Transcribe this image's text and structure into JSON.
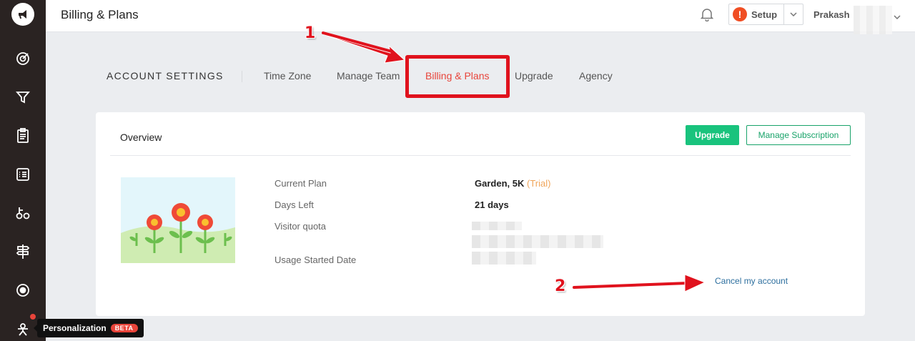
{
  "header": {
    "title": "Billing & Plans",
    "setup_label": "Setup",
    "setup_alert": "!",
    "user_name": "Prakash"
  },
  "sidebar": {
    "items": [
      {
        "icon": "target-icon"
      },
      {
        "icon": "funnel-icon"
      },
      {
        "icon": "clipboard-icon"
      },
      {
        "icon": "form-list-icon"
      },
      {
        "icon": "cycle-icon"
      },
      {
        "icon": "signpost-icon"
      },
      {
        "icon": "record-icon"
      },
      {
        "icon": "personalization-icon"
      }
    ],
    "tooltip": {
      "label": "Personalization",
      "badge": "BETA"
    }
  },
  "subnav": {
    "title": "ACCOUNT SETTINGS",
    "tabs": [
      {
        "label": "Time Zone"
      },
      {
        "label": "Manage Team"
      },
      {
        "label": "Billing & Plans",
        "active": true
      },
      {
        "label": "Upgrade"
      },
      {
        "label": "Agency"
      }
    ]
  },
  "card": {
    "title": "Overview",
    "upgrade_button": "Upgrade",
    "manage_button": "Manage Subscription",
    "rows": [
      {
        "label": "Current Plan",
        "value": "Garden, 5K",
        "suffix": "(Trial)"
      },
      {
        "label": "Days Left",
        "value": "21 days"
      },
      {
        "label": "Visitor quota"
      },
      {
        "label": "Usage Started Date"
      }
    ],
    "cancel_link": "Cancel my account"
  },
  "annotations": {
    "one": "1",
    "two": "2"
  },
  "colors": {
    "accent_red": "#e8443a",
    "green": "#19c37d",
    "link": "#2c6e9e",
    "annotation": "#e0121d"
  }
}
